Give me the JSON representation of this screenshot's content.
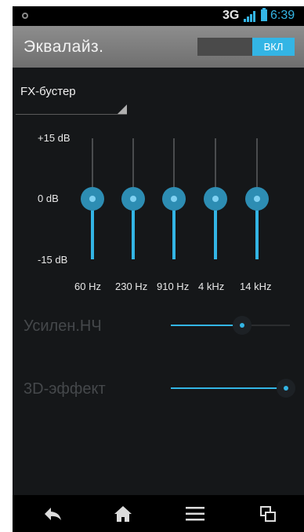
{
  "status_bar": {
    "network": "3G",
    "time": "6:39",
    "colors": {
      "accent": "#33b5e5"
    }
  },
  "header": {
    "title": "Эквалайз.",
    "power_switch_label": "ВКЛ",
    "power_on": true
  },
  "preset": {
    "selected": "FX-бустер"
  },
  "equalizer": {
    "db_labels": {
      "max": "+15 dB",
      "mid": "0 dB",
      "min": "-15 dB"
    },
    "bands": [
      {
        "freq": "60 Hz",
        "gain_db": 0
      },
      {
        "freq": "230 Hz",
        "gain_db": 0
      },
      {
        "freq": "910 Hz",
        "gain_db": 0
      },
      {
        "freq": "4 kHz",
        "gain_db": 0
      },
      {
        "freq": "14 kHz",
        "gain_db": 0
      }
    ]
  },
  "effects": {
    "bass_boost": {
      "label": "Усилен.НЧ",
      "level_fraction": 0.6,
      "enabled": false
    },
    "virtualizer": {
      "label": "3D-эффект",
      "level_fraction": 0.97,
      "enabled": false
    }
  },
  "nav_bar": {
    "icons": [
      "back-icon",
      "home-icon",
      "menu-icon",
      "recent-apps-icon"
    ]
  }
}
